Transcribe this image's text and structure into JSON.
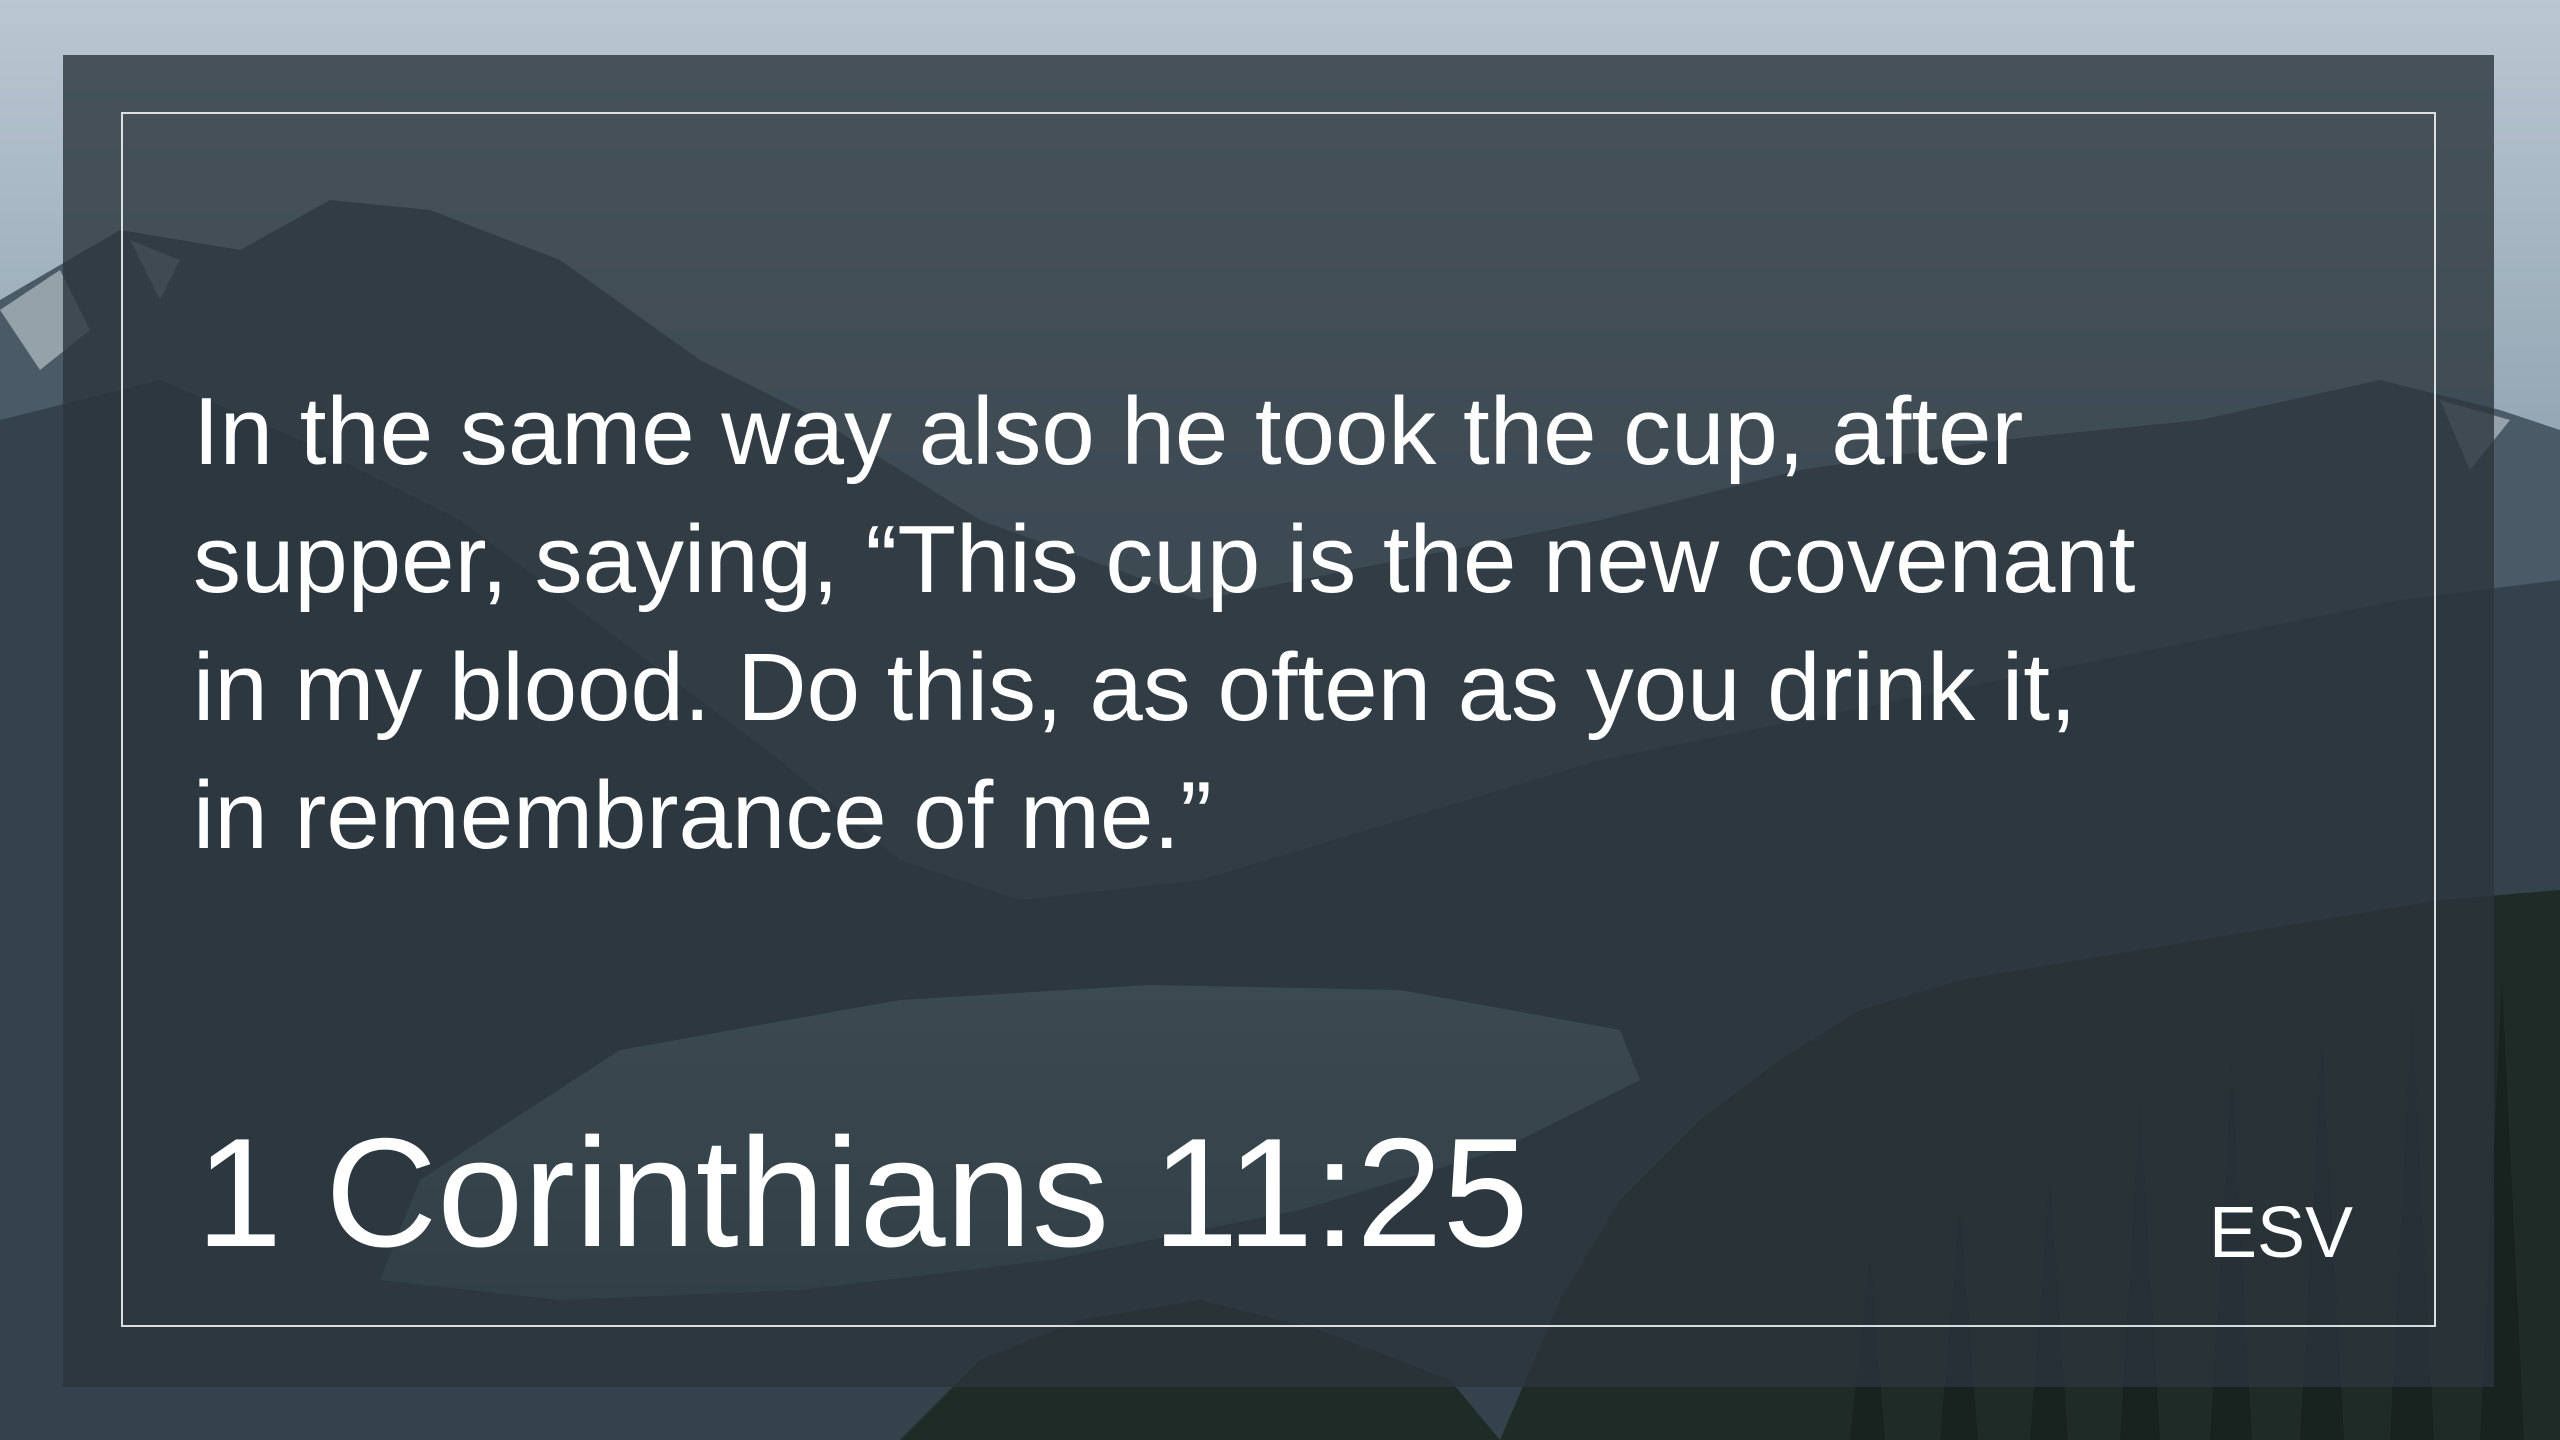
{
  "slide": {
    "verse_text": "In the same way also he took the cup, after\nsupper, saying, “This cup is the new covenant\nin my blood. Do this, as often as you drink it,\nin remembrance of me.”",
    "reference": "1 Corinthians 11:25",
    "version": "ESV"
  },
  "background": {
    "scene": "mountain-lake-landscape",
    "colors": {
      "sky": "#aebdc8",
      "mountains": "#3c4a55",
      "lake": "#6a8790",
      "forest": "#1e2a26",
      "panel": "#2a343c",
      "frame_line": "#ebf0f2"
    }
  }
}
